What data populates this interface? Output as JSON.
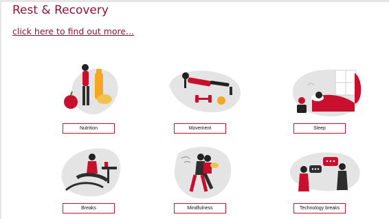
{
  "page": {
    "title": "Rest & Recovery",
    "link_text": "click here to find out more..."
  },
  "cards": [
    {
      "label": "Nutrition",
      "icon": "nutrition-illustration"
    },
    {
      "label": "Movement",
      "icon": "movement-illustration"
    },
    {
      "label": "Sleep",
      "icon": "sleep-illustration"
    },
    {
      "label": "Breaks",
      "icon": "breaks-illustration"
    },
    {
      "label": "Mindfulness",
      "icon": "mindfulness-illustration"
    },
    {
      "label": "Technology breaks",
      "icon": "technology-breaks-illustration"
    }
  ],
  "colors": {
    "accent": "#c8102e",
    "title": "#8a1538",
    "blob": "#e4e4e4"
  }
}
